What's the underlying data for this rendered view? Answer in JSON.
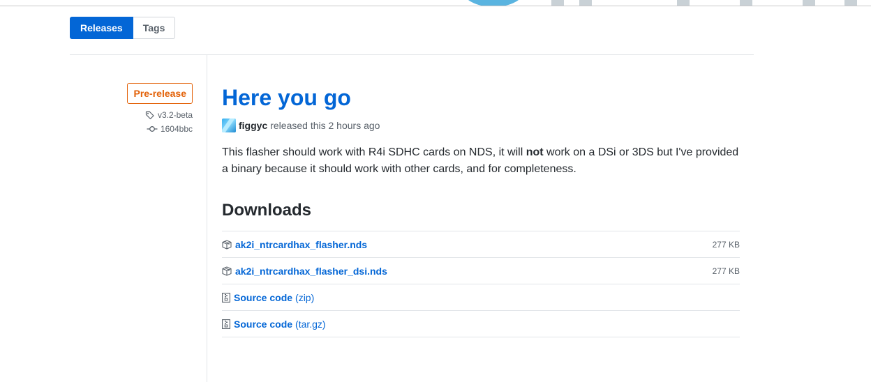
{
  "tabs": [
    {
      "label": "Releases",
      "active": true
    },
    {
      "label": "Tags",
      "active": false
    }
  ],
  "release": {
    "badge": "Pre-release",
    "tag": "v3.2-beta",
    "commit": "1604bbc",
    "title": "Here you go",
    "author": "figgyc",
    "released_text": "released this 2 hours ago",
    "body_part1": "This flasher should work with R4i SDHC cards on NDS, it will ",
    "body_bold": "not",
    "body_part2": " work on a DSi or 3DS but I've provided a binary because it should work with other cards, and for completeness."
  },
  "downloads": {
    "title": "Downloads",
    "items": [
      {
        "name": "ak2i_ntrcardhax_flasher.nds",
        "suffix": "",
        "size": "277 KB",
        "icon": "package-icon"
      },
      {
        "name": "ak2i_ntrcardhax_flasher_dsi.nds",
        "suffix": "",
        "size": "277 KB",
        "icon": "package-icon"
      },
      {
        "name": "Source code",
        "suffix": "(zip)",
        "size": "",
        "icon": "file-zip-icon"
      },
      {
        "name": "Source code",
        "suffix": "(tar.gz)",
        "size": "",
        "icon": "file-zip-icon"
      }
    ]
  },
  "colors": {
    "accent": "#0366d6",
    "prerelease": "#e36209",
    "muted": "#586069"
  }
}
